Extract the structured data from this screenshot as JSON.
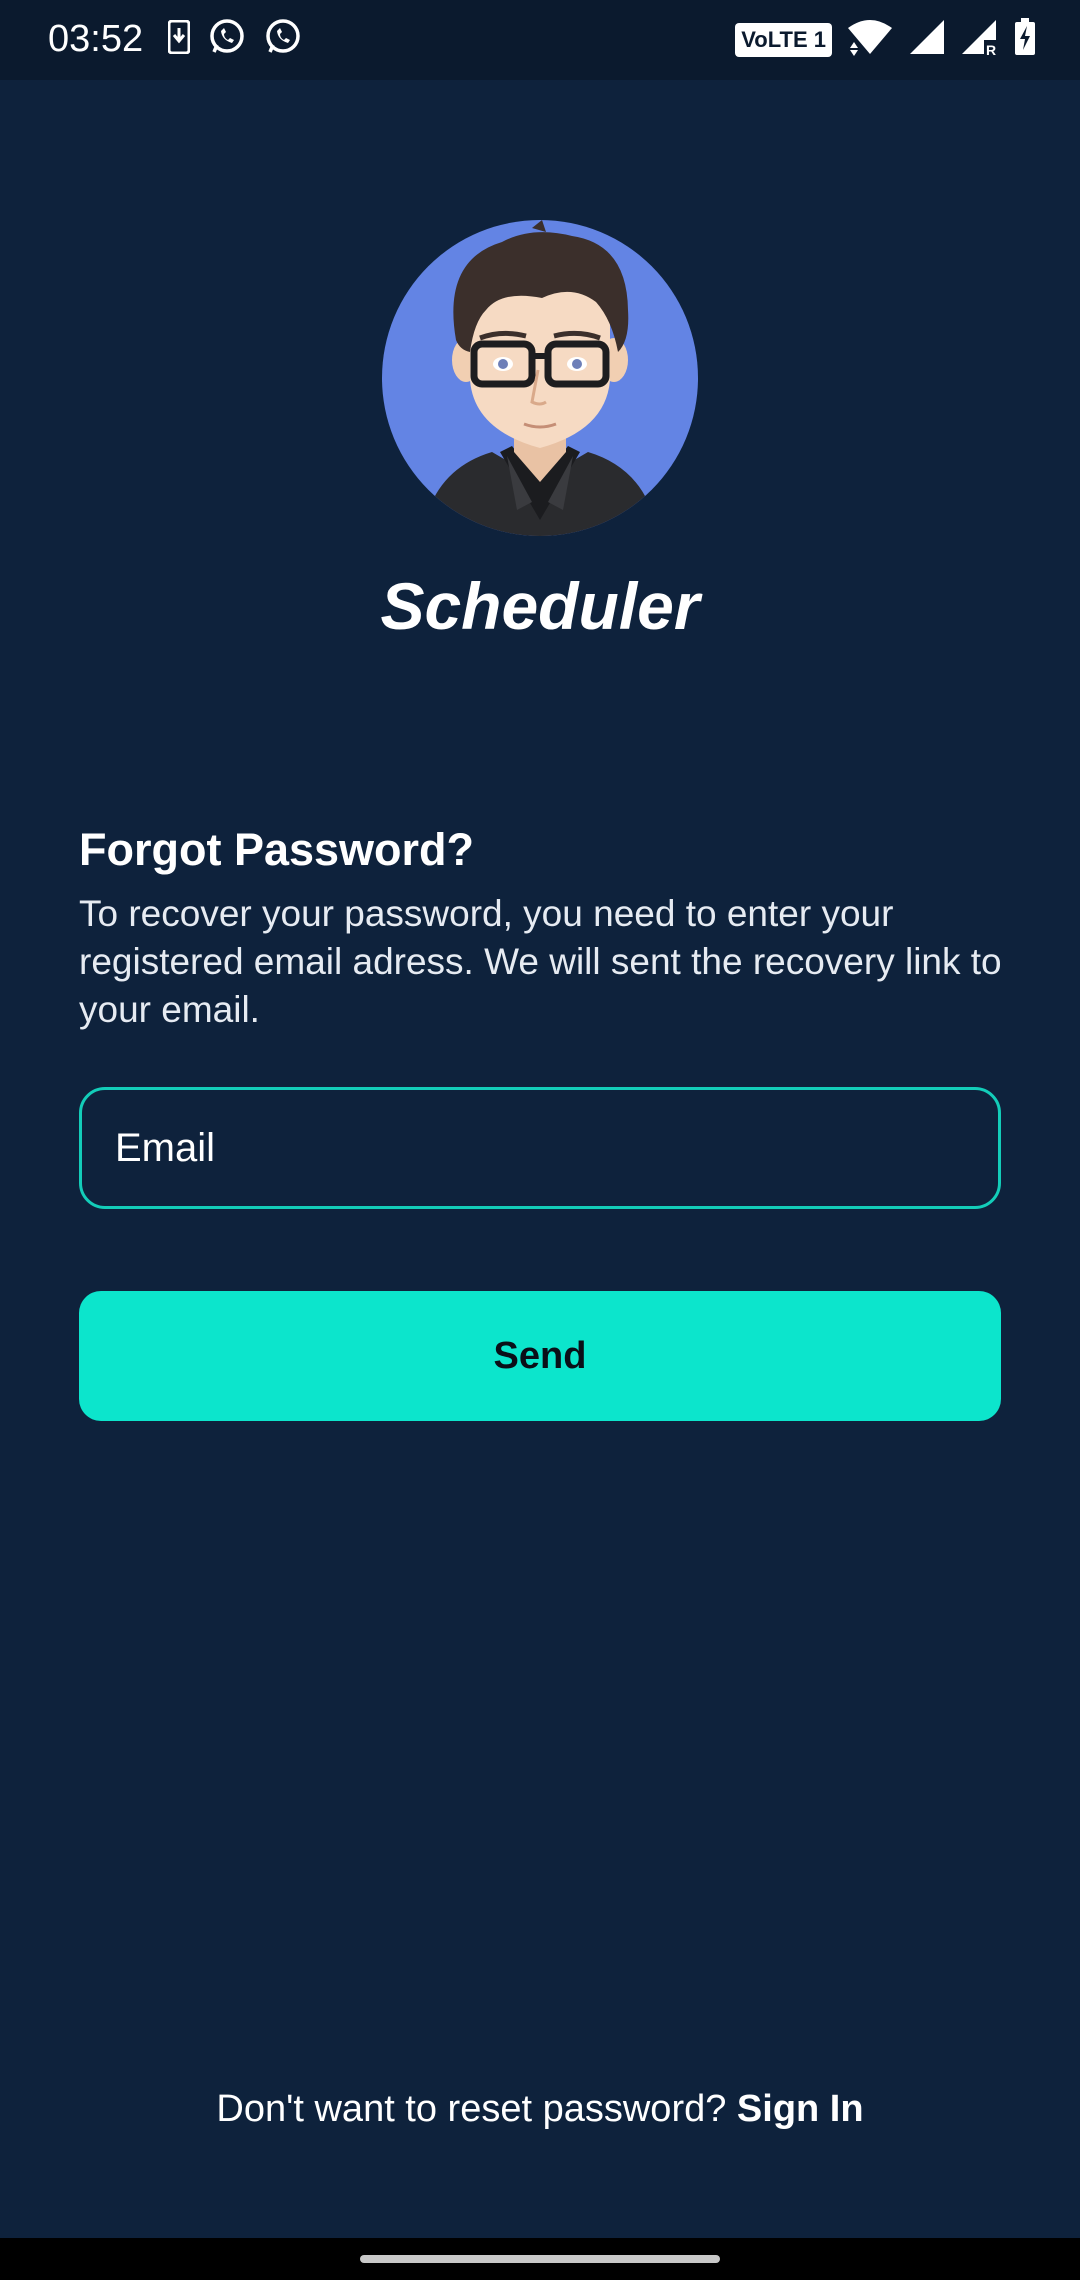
{
  "status_bar": {
    "time": "03:52",
    "network_badge": "VoLTE 1",
    "left_icons": [
      "download-icon",
      "whatsapp-icon",
      "whatsapp-icon"
    ],
    "right_icons": [
      "wifi-icon",
      "signal-icon",
      "signal-roaming-icon",
      "battery-charging-icon"
    ]
  },
  "app": {
    "title": "Scheduler"
  },
  "form": {
    "heading": "Forgot Password?",
    "description": "To recover your password, you need to enter your registered email adress. We will sent the recovery link to your email.",
    "email_placeholder": "Email",
    "email_value": "",
    "send_label": "Send"
  },
  "footer": {
    "prompt": "Don't want to reset password?",
    "link_label": "Sign In"
  },
  "colors": {
    "background": "#0e223c",
    "accent": "#0ce5cc",
    "field_border": "#13cdb9",
    "avatar_bg": "#6384e4"
  }
}
